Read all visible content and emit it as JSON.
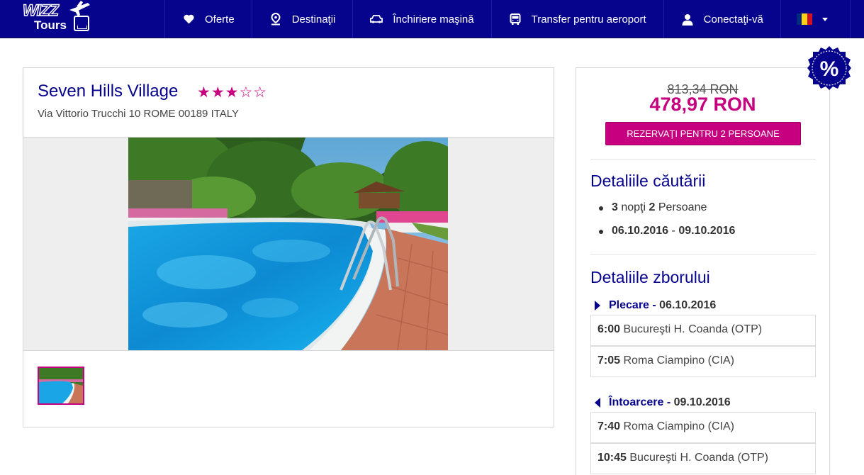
{
  "brand": {
    "line1": "WIZZ",
    "line2": "Tours"
  },
  "nav": {
    "items": [
      {
        "label": "Oferte",
        "icon": "heart-icon"
      },
      {
        "label": "Destinaţii",
        "icon": "map-pin-icon"
      },
      {
        "label": "Închiriere maşină",
        "icon": "car-icon"
      },
      {
        "label": "Transfer pentru aeroport",
        "icon": "bus-icon"
      },
      {
        "label": "Conectaţi-vă",
        "icon": "user-icon"
      }
    ],
    "language_flag": "romania-flag"
  },
  "hotel": {
    "name": "Seven Hills Village",
    "stars": "★★★☆☆",
    "star_rating": 3,
    "address": "Via Vittorio Trucchi 10 ROME 00189 ITALY"
  },
  "pricing": {
    "old_price": "813,34 RON",
    "new_price": "478,97 RON",
    "book_label": "REZERVAŢI PENTRU 2 PERSOANE",
    "discount_badge": "%"
  },
  "search": {
    "title": "Detaliile căutării",
    "nights": "3",
    "nights_label": "nopţi",
    "persons": "2",
    "persons_label": "Persoane",
    "date_from": "06.10.2016",
    "date_sep": "-",
    "date_to": "09.10.2016"
  },
  "flights": {
    "title": "Detaliile zborului",
    "outbound": {
      "label": "Plecare",
      "date": "06.10.2016",
      "rows": [
        {
          "time": "6:00",
          "place": "Bucureşti H. Coanda (OTP)"
        },
        {
          "time": "7:05",
          "place": "Roma Ciampino (CIA)"
        }
      ]
    },
    "return": {
      "label": "Întoarcere",
      "date": "09.10.2016",
      "rows": [
        {
          "time": "7:40",
          "place": "Roma Ciampino (CIA)"
        },
        {
          "time": "10:45",
          "place": "Bucureşti H. Coanda (OTP)"
        }
      ]
    }
  },
  "colors": {
    "nav_blue": "#06038d",
    "accent_magenta": "#c6007e"
  }
}
